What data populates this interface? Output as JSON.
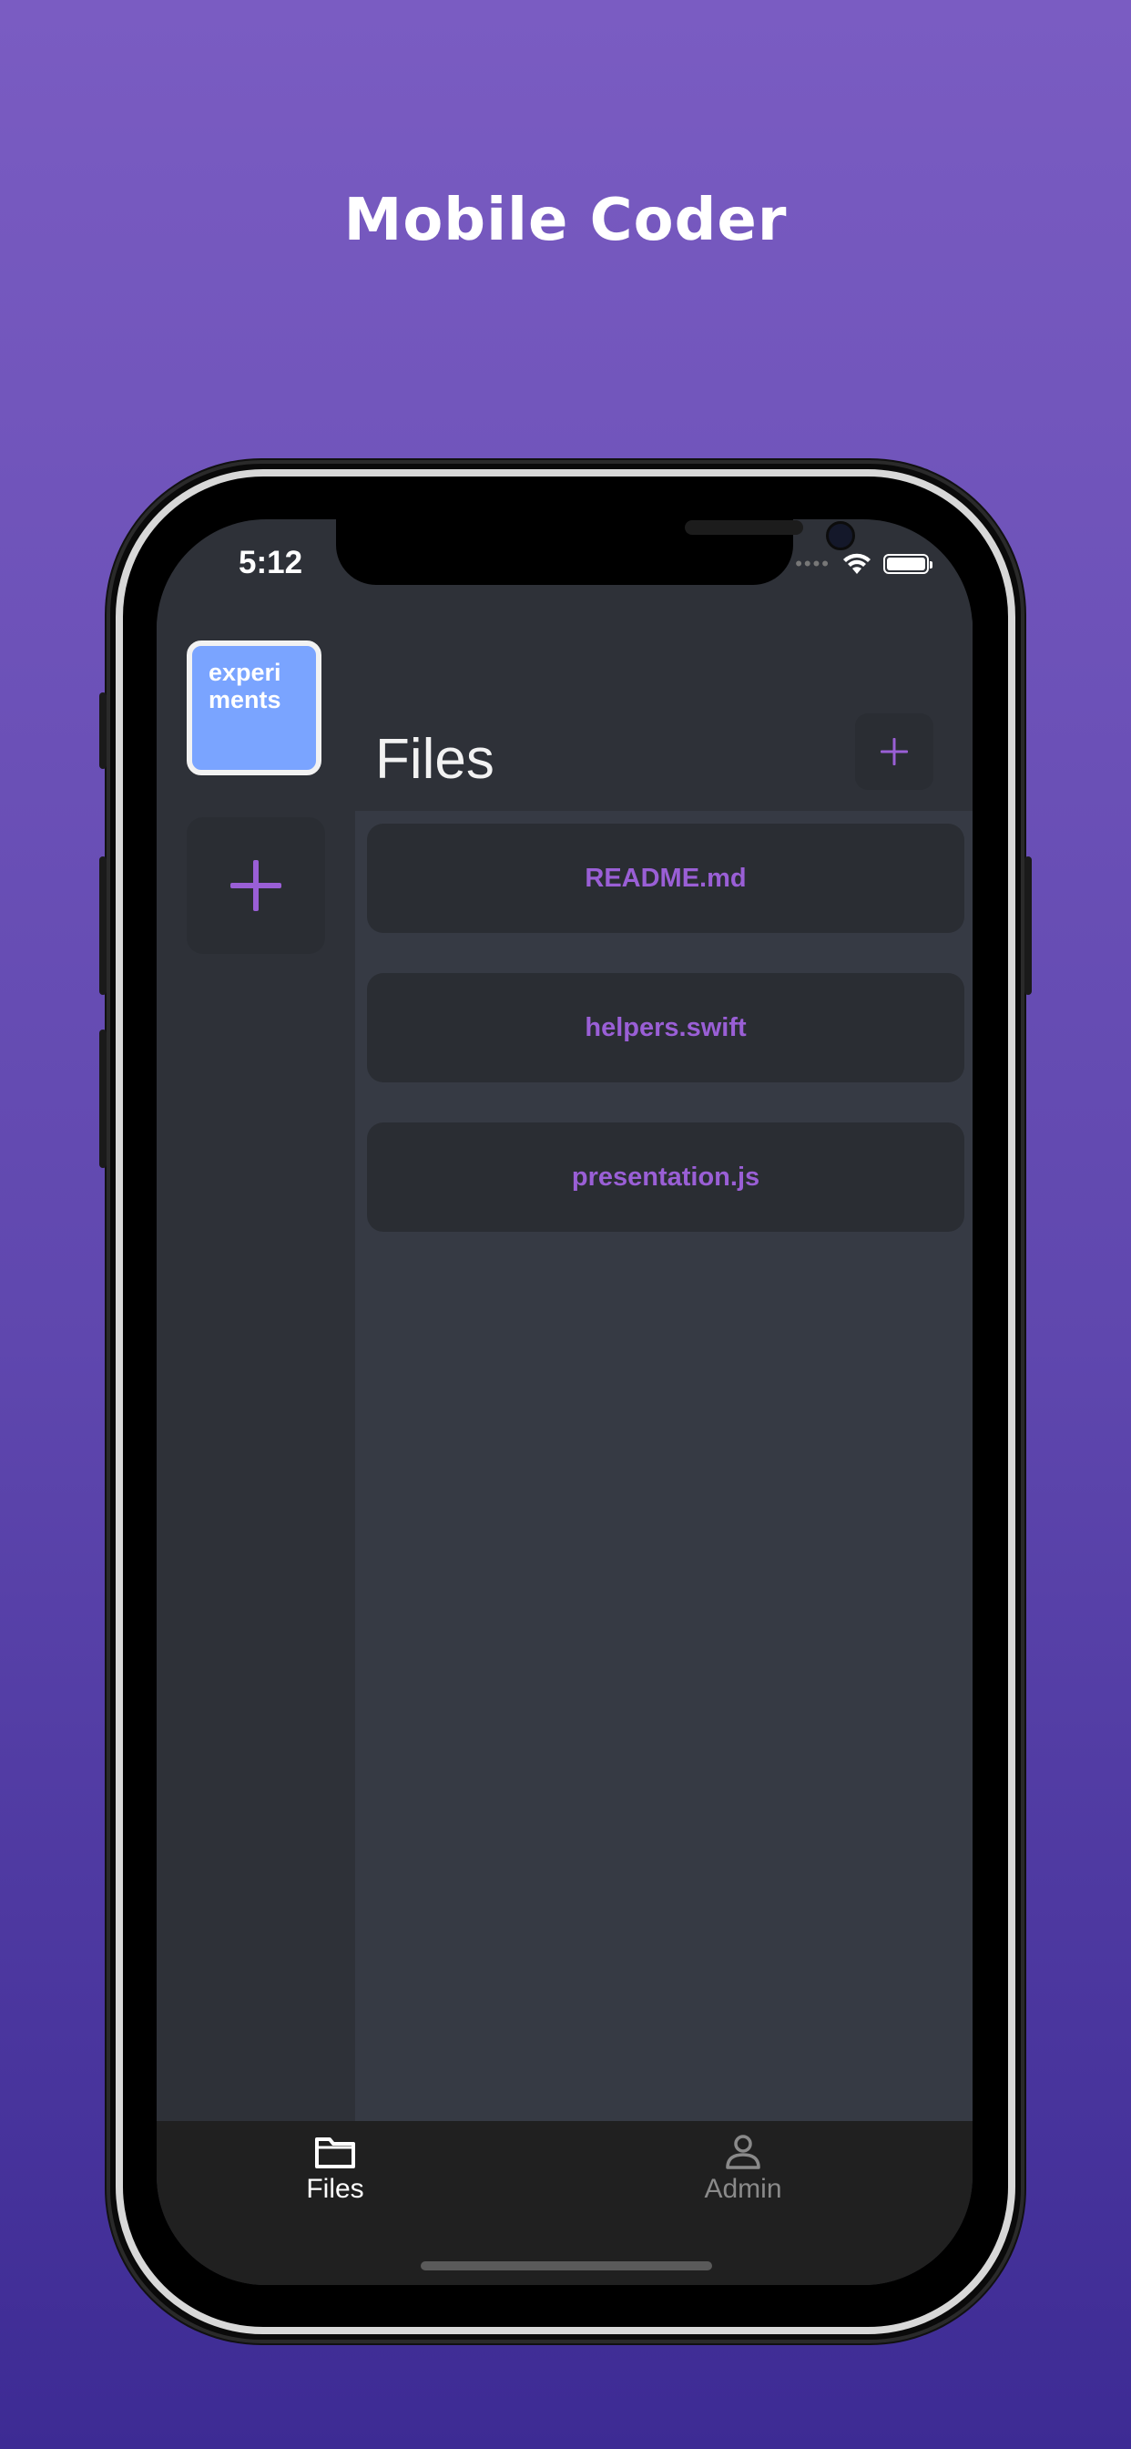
{
  "headline": "Mobile Coder",
  "status_bar": {
    "time": "5:12",
    "signal_icon": "signal-dots-icon",
    "wifi_icon": "wifi-icon",
    "battery_icon": "battery-icon"
  },
  "sidebar": {
    "project_tile_label": "experi ments",
    "project_tile_color": "#7aa4ff",
    "add_project_icon": "plus-icon"
  },
  "main": {
    "title": "Files",
    "add_file_icon": "plus-icon",
    "files": [
      {
        "name": "README.md"
      },
      {
        "name": "helpers.swift"
      },
      {
        "name": "presentation.js"
      }
    ]
  },
  "tabbar": {
    "tabs": [
      {
        "label": "Files",
        "icon": "folder-icon",
        "active": true
      },
      {
        "label": "Admin",
        "icon": "person-icon",
        "active": false
      }
    ]
  },
  "colors": {
    "accent": "#9a5fd6",
    "background_top": "#7a5cc2",
    "background_bottom": "#3d2b94",
    "tab_active": "#ffffff",
    "tab_inactive": "#8a8a8a"
  }
}
